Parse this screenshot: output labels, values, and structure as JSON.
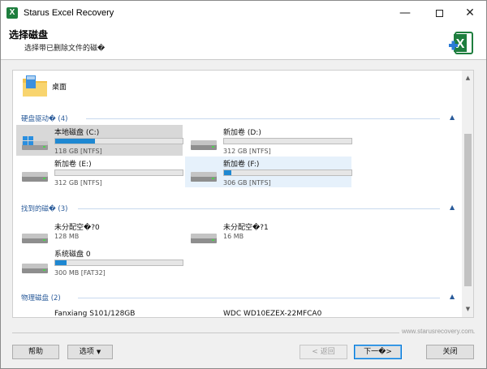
{
  "window": {
    "title": "Starus Excel Recovery",
    "app_icon_letter": "X",
    "controls": {
      "minimize": "—",
      "close": "✕"
    }
  },
  "header": {
    "title": "选择磁盘",
    "subtitle": "选择带已删除文件的磁�",
    "logo_icon": "excel-plus-icon"
  },
  "desktop": {
    "label": "桌面",
    "icon": "folder-icon"
  },
  "groups": [
    {
      "title": "硬盘驱动� (4)",
      "tiles": [
        {
          "name": "本地磁盘 (C:)",
          "info": "118 GB [NTFS]",
          "used": 0.31,
          "icon": "windows-drive-icon",
          "state": "selected"
        },
        {
          "name": "新加卷 (D:)",
          "info": "312 GB [NTFS]",
          "used": 0.0,
          "icon": "hard-drive-icon",
          "state": "normal"
        },
        {
          "name": "新加卷 (E:)",
          "info": "312 GB [NTFS]",
          "used": 0.0,
          "icon": "hard-drive-icon",
          "state": "normal"
        },
        {
          "name": "新加卷 (F:)",
          "info": "306 GB [NTFS]",
          "used": 0.06,
          "icon": "hard-drive-icon",
          "state": "hover"
        }
      ]
    },
    {
      "title": "找到的磁� (3)",
      "tiles": [
        {
          "name": "未分配空�?0",
          "info": "128 MB",
          "icon": "hard-drive-icon"
        },
        {
          "name": "未分配空�?1",
          "info": "16 MB",
          "icon": "hard-drive-icon"
        },
        {
          "name": "系统磁盘 0",
          "info": "300 MB [FAT32]",
          "used": 0.09,
          "icon": "hard-drive-icon"
        }
      ]
    },
    {
      "title": "物理磁盘 (2)",
      "tiles": [
        {
          "name": "Fanxiang S101/128GB",
          "icon": "hard-drive-icon"
        },
        {
          "name": "WDC WD10EZEX-22MFCA0",
          "icon": "hard-drive-icon"
        }
      ]
    }
  ],
  "footer": {
    "website": "www.starusrecovery.com",
    "help": "帮助",
    "options": "选项",
    "back": "< 返回",
    "next": "下一�>",
    "close": "关闭"
  },
  "colors": {
    "progress": "#1e88d2",
    "group_text": "#2a5b9a",
    "selected_bg": "#d8d8d8",
    "hover_bg": "#e6f1fb",
    "excel_green": "#1e7e3e"
  }
}
